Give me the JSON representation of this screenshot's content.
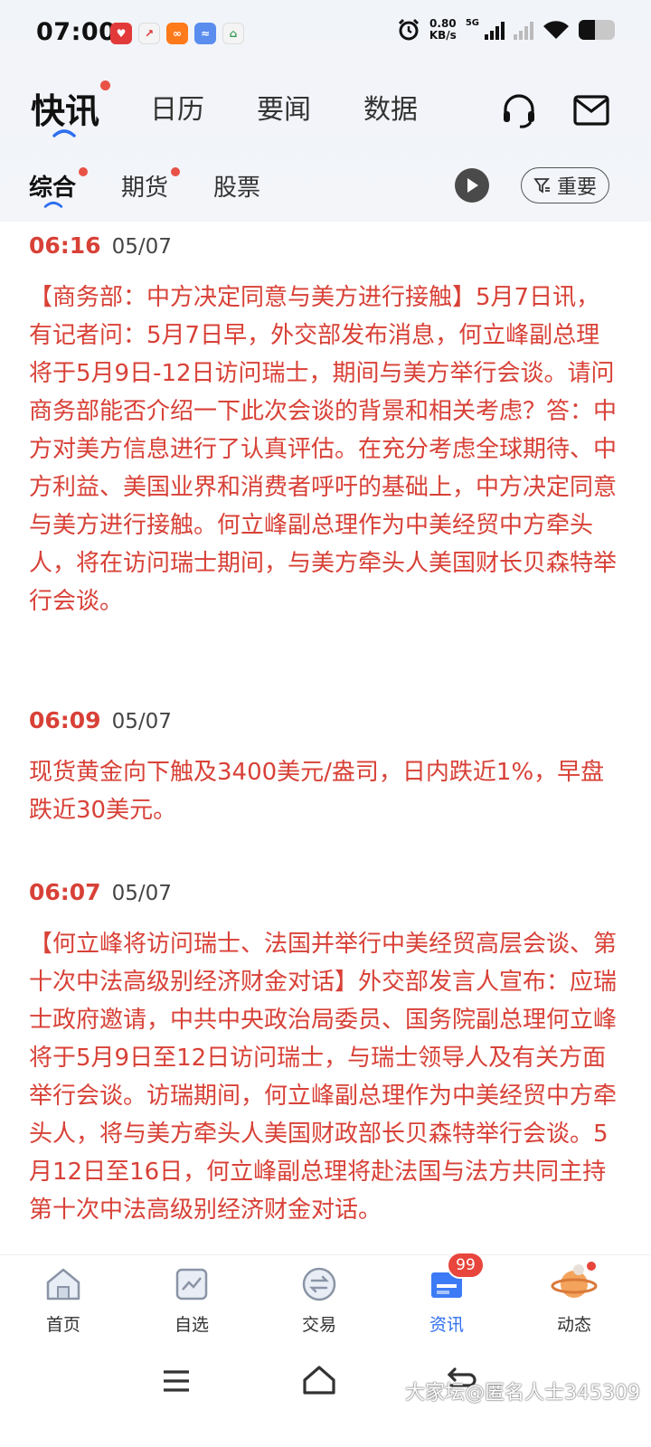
{
  "status": {
    "time": "07:00",
    "net_speed_value": "0.80",
    "net_speed_unit": "KB/s",
    "network": "5G"
  },
  "header": {
    "tabs": [
      {
        "label": "快讯",
        "active": true,
        "dot": true
      },
      {
        "label": "日历"
      },
      {
        "label": "要闻"
      },
      {
        "label": "数据"
      }
    ]
  },
  "subtabs": {
    "items": [
      {
        "label": "综合",
        "active": true,
        "dot": true
      },
      {
        "label": "期货",
        "dot": true
      },
      {
        "label": "股票"
      }
    ],
    "filter_label": "重要"
  },
  "news": [
    {
      "time": "06:16",
      "date": "05/07",
      "text": "【商务部：中方决定同意与美方进行接触】5月7日讯，有记者问：5月7日早，外交部发布消息，何立峰副总理将于5月9日-12日访问瑞士，期间与美方举行会谈。请问商务部能否介绍一下此次会谈的背景和相关考虑？答：中方对美方信息进行了认真评估。在充分考虑全球期待、中方利益、美国业界和消费者呼吁的基础上，中方决定同意与美方进行接触。何立峰副总理作为中美经贸中方牵头人，将在访问瑞士期间，与美方牵头人美国财长贝森特举行会谈。"
    },
    {
      "time": "06:09",
      "date": "05/07",
      "text": "现货黄金向下触及3400美元/盎司，日内跌近1%，早盘跌近30美元。"
    },
    {
      "time": "06:07",
      "date": "05/07",
      "text": "【何立峰将访问瑞士、法国并举行中美经贸高层会谈、第十次中法高级别经济财金对话】外交部发言人宣布：应瑞士政府邀请，中共中央政治局委员、国务院副总理何立峰将于5月9日至12日访问瑞士，与瑞士领导人及有关方面举行会谈。访瑞期间，何立峰副总理作为中美经贸中方牵头人，将与美方牵头人美国财政部长贝森特举行会谈。5月12日至16日，何立峰副总理将赴法国与法方共同主持第十次中法高级别经济财金对话。"
    }
  ],
  "bottom_nav": [
    {
      "label": "首页",
      "icon": "home-icon"
    },
    {
      "label": "自选",
      "icon": "watchlist-icon"
    },
    {
      "label": "交易",
      "icon": "trade-icon"
    },
    {
      "label": "资讯",
      "icon": "news-icon",
      "active": true,
      "badge": "99"
    },
    {
      "label": "动态",
      "icon": "planet-icon",
      "dot": true
    }
  ],
  "watermark": "大家坛@匿名人士345309",
  "colors": {
    "accent_red": "#d84137",
    "active_blue": "#2f6ff0",
    "badge_red": "#e8453c"
  }
}
